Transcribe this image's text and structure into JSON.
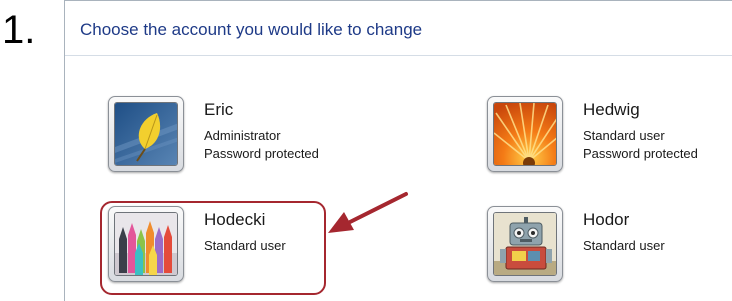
{
  "step": {
    "number": "1."
  },
  "panel": {
    "title": "Choose the account you would like to change"
  },
  "accounts": [
    {
      "name": "Eric",
      "line1": "Administrator",
      "line2": "Password protected",
      "picture_icon": "leaf-picture-icon"
    },
    {
      "name": "Hedwig",
      "line1": "Standard user",
      "line2": "Password protected",
      "picture_icon": "flower-picture-icon"
    },
    {
      "name": "Hodecki",
      "line1": "Standard user",
      "line2": "",
      "picture_icon": "crayons-picture-icon"
    },
    {
      "name": "Hodor",
      "line1": "Standard user",
      "line2": "",
      "picture_icon": "robot-picture-icon"
    }
  ],
  "colors": {
    "title_blue": "#1e3a87",
    "highlight_red": "#a5272f"
  }
}
